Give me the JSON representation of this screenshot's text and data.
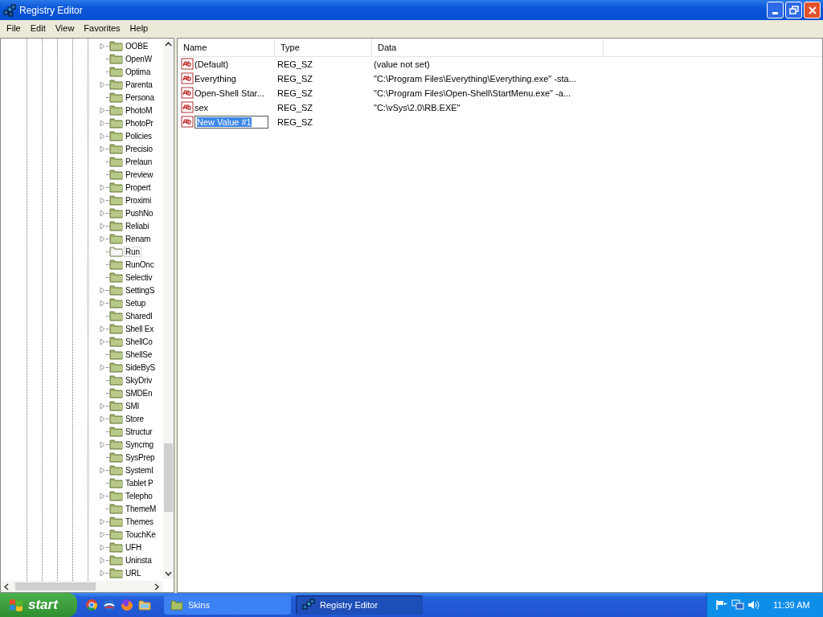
{
  "window": {
    "title": "Registry Editor"
  },
  "menu": [
    "File",
    "Edit",
    "View",
    "Favorites",
    "Help"
  ],
  "tree": [
    {
      "label": "OOBE",
      "expandable": true,
      "selected": false
    },
    {
      "label": "OpenW",
      "expandable": false,
      "selected": false
    },
    {
      "label": "Optima",
      "expandable": false,
      "selected": false
    },
    {
      "label": "Parenta",
      "expandable": true,
      "selected": false
    },
    {
      "label": "Persona",
      "expandable": false,
      "selected": false
    },
    {
      "label": "PhotoM",
      "expandable": true,
      "selected": false
    },
    {
      "label": "PhotoPr",
      "expandable": true,
      "selected": false
    },
    {
      "label": "Policies",
      "expandable": true,
      "selected": false
    },
    {
      "label": "Precisio",
      "expandable": true,
      "selected": false
    },
    {
      "label": "Prelaun",
      "expandable": false,
      "selected": false
    },
    {
      "label": "Preview",
      "expandable": false,
      "selected": false
    },
    {
      "label": "Propert",
      "expandable": true,
      "selected": false
    },
    {
      "label": "Proximi",
      "expandable": true,
      "selected": false
    },
    {
      "label": "PushNo",
      "expandable": true,
      "selected": false
    },
    {
      "label": "Reliabi",
      "expandable": true,
      "selected": false
    },
    {
      "label": "Renam",
      "expandable": true,
      "selected": false
    },
    {
      "label": "Run",
      "expandable": false,
      "selected": true
    },
    {
      "label": "RunOnc",
      "expandable": false,
      "selected": false
    },
    {
      "label": "Selectiv",
      "expandable": false,
      "selected": false
    },
    {
      "label": "SettingS",
      "expandable": true,
      "selected": false
    },
    {
      "label": "Setup",
      "expandable": true,
      "selected": false
    },
    {
      "label": "SharedI",
      "expandable": false,
      "selected": false
    },
    {
      "label": "Shell Ex",
      "expandable": true,
      "selected": false
    },
    {
      "label": "ShellCo",
      "expandable": true,
      "selected": false
    },
    {
      "label": "ShellSe",
      "expandable": false,
      "selected": false
    },
    {
      "label": "SideByS",
      "expandable": true,
      "selected": false
    },
    {
      "label": "SkyDriv",
      "expandable": false,
      "selected": false
    },
    {
      "label": "SMDEn",
      "expandable": false,
      "selected": false
    },
    {
      "label": "SMI",
      "expandable": true,
      "selected": false
    },
    {
      "label": "Store",
      "expandable": true,
      "selected": false
    },
    {
      "label": "Structur",
      "expandable": false,
      "selected": false
    },
    {
      "label": "Syncmg",
      "expandable": true,
      "selected": false
    },
    {
      "label": "SysPrep",
      "expandable": false,
      "selected": false
    },
    {
      "label": "SystemI",
      "expandable": true,
      "selected": false
    },
    {
      "label": "Tablet P",
      "expandable": false,
      "selected": false
    },
    {
      "label": "Telepho",
      "expandable": true,
      "selected": false
    },
    {
      "label": "ThemeM",
      "expandable": false,
      "selected": false
    },
    {
      "label": "Themes",
      "expandable": true,
      "selected": false
    },
    {
      "label": "TouchKe",
      "expandable": true,
      "selected": false
    },
    {
      "label": "UFH",
      "expandable": true,
      "selected": false
    },
    {
      "label": "Uninsta",
      "expandable": true,
      "selected": false
    },
    {
      "label": "URL",
      "expandable": true,
      "selected": false
    }
  ],
  "table": {
    "columns": [
      "Name",
      "Type",
      "Data"
    ],
    "rows": [
      {
        "name": "(Default)",
        "type": "REG_SZ",
        "data": "(value not set)",
        "editing": false
      },
      {
        "name": "Everything",
        "type": "REG_SZ",
        "data": "\"C:\\Program Files\\Everything\\Everything.exe\" -sta...",
        "editing": false
      },
      {
        "name": "Open-Shell Star...",
        "type": "REG_SZ",
        "data": "\"C:\\Program Files\\Open-Shell\\StartMenu.exe\" -a...",
        "editing": false
      },
      {
        "name": "sex",
        "type": "REG_SZ",
        "data": "\"C:\\vSys\\2.0\\RB.EXE\"",
        "editing": false
      },
      {
        "name": "New Value #1",
        "type": "REG_SZ",
        "editing": true
      }
    ]
  },
  "taskbar": {
    "start": "start",
    "tasks": [
      {
        "label": "Skins",
        "selected": false
      },
      {
        "label": "Registry Editor",
        "selected": true
      }
    ],
    "time": "11:39 AM"
  }
}
